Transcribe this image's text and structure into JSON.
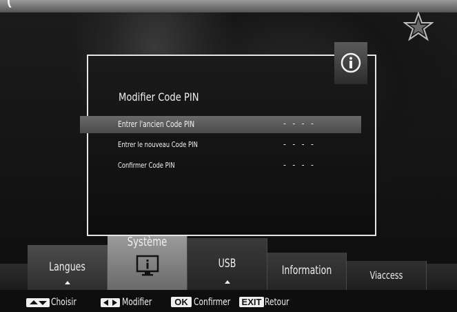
{
  "top_banner": {
    "text": "("
  },
  "dialog": {
    "title": "Modifier Code PIN",
    "rows": [
      {
        "label": "Entrer l'ancien Code PIN",
        "value": "- - - -",
        "selected": true
      },
      {
        "label": "Entrer le nouveau Code PIN",
        "value": "- - - -",
        "selected": false
      },
      {
        "label": "Confirmer Code PIN",
        "value": "- - - -",
        "selected": false
      }
    ],
    "icon": "info-icon"
  },
  "tabs": [
    {
      "label": "Langues",
      "active": false
    },
    {
      "label": "Système",
      "active": true,
      "icon": "monitor-info-icon"
    },
    {
      "label": "USB",
      "active": false
    },
    {
      "label": "Information",
      "active": false
    },
    {
      "label": "Viaccess",
      "active": false
    }
  ],
  "footer": {
    "choose": "Choisir",
    "modify": "Modifier",
    "ok_key": "OK",
    "confirm": "Confirmer",
    "exit_key": "EXIT",
    "back": "Retour"
  },
  "colors": {
    "panel_border": "#e6e6e6",
    "selected_row": "#5a5a5a",
    "active_tab": "#8a8a8a"
  }
}
